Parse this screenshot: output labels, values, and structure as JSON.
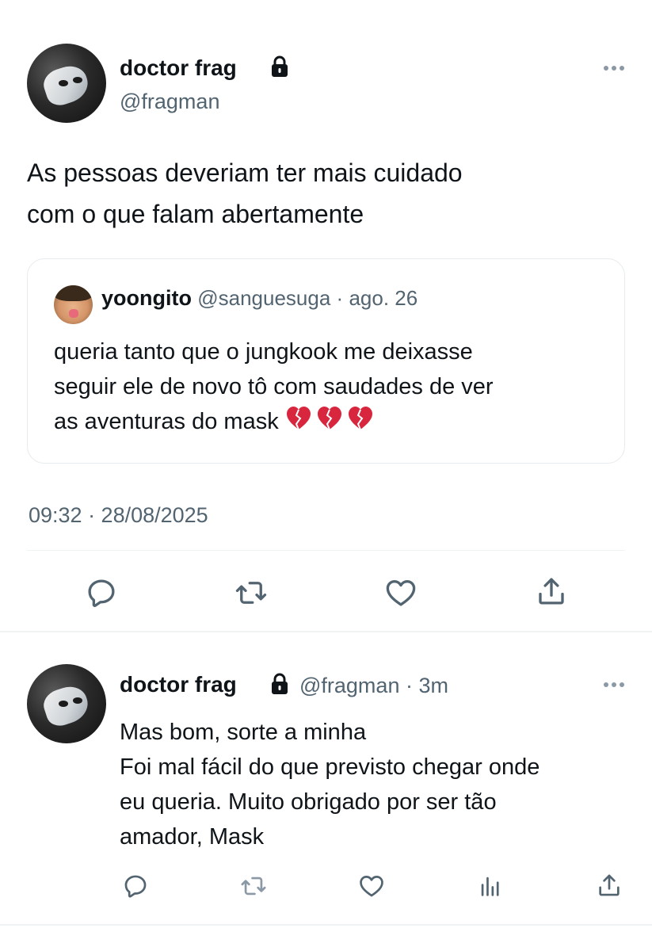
{
  "main_tweet": {
    "author_name": "doctor frag",
    "author_handle": "@fragman",
    "text_lines": [
      "As pessoas deveriam ter mais cuidado",
      "com o que falam abertamente"
    ],
    "timestamp": "09:32 · 28/08/2025",
    "quoted": {
      "author_name": "yoongito",
      "author_handle": "@sanguesuga",
      "separator": "·",
      "time": "ago. 26",
      "text_lines": [
        "queria tanto que o jungkook me deixasse",
        "seguir ele de novo tô com saudades de ver",
        "as aventuras do mask"
      ],
      "emoji": "💔💔💔"
    }
  },
  "reply_tweet": {
    "author_name": "doctor frag",
    "author_handle": "@fragman",
    "separator": "·",
    "time": "3m",
    "text_lines": [
      "Mas bom, sorte a minha",
      "Foi mal fácil do que previsto chegar onde",
      "eu queria. Muito obrigado por ser tão",
      "amador, Mask"
    ]
  },
  "icons": {
    "lock": "lock-icon",
    "more": "more-icon",
    "reply": "reply-icon",
    "retweet": "retweet-icon",
    "like": "heart-icon",
    "share": "share-icon",
    "views": "views-icon",
    "broken_heart": "broken-heart-icon"
  },
  "colors": {
    "text_primary": "#0f1419",
    "text_secondary": "#536471",
    "icon_gray": "#536471",
    "border": "#e6ebee",
    "broken_heart_red": "#d7263d"
  }
}
